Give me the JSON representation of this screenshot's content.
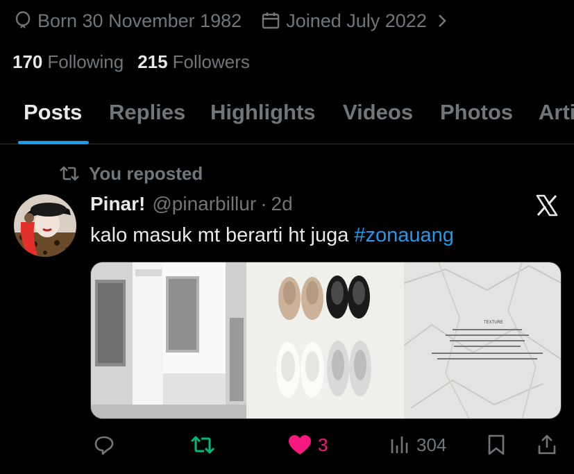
{
  "profile": {
    "born": "Born 30 November 1982",
    "joined": "Joined July 2022",
    "following_count": "170",
    "following_label": "Following",
    "followers_count": "215",
    "followers_label": "Followers"
  },
  "tabs": [
    {
      "label": "Posts",
      "active": true
    },
    {
      "label": "Replies"
    },
    {
      "label": "Highlights"
    },
    {
      "label": "Videos"
    },
    {
      "label": "Photos"
    },
    {
      "label": "Arti"
    }
  ],
  "post": {
    "repost_label": "You reposted",
    "author_name": "Pinar!",
    "author_handle": "@pinarbillur",
    "dot": "·",
    "time": "2d",
    "text": "kalo masuk mt berarti ht juga",
    "hashtag": "#zonauang",
    "media_texture_label": "TEXTURE",
    "actions": {
      "reply_count": "",
      "repost_count": "",
      "like_count": "3",
      "views_count": "304"
    }
  },
  "colors": {
    "accent": "#1d9bf0",
    "muted": "#71767b",
    "like": "#f91880",
    "repost": "#00ba7c",
    "background": "#000000"
  }
}
